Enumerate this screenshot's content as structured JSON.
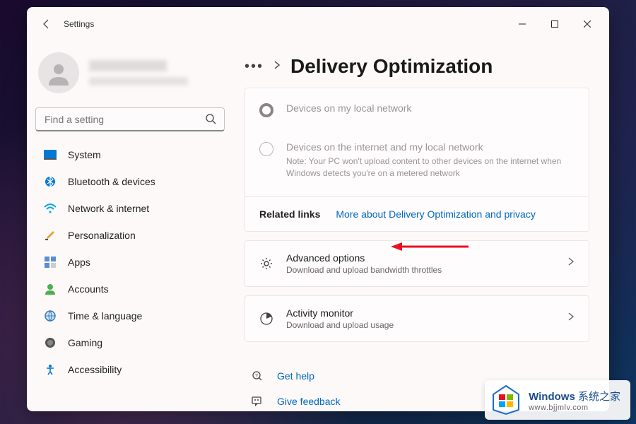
{
  "window": {
    "title": "Settings"
  },
  "search": {
    "placeholder": "Find a setting"
  },
  "nav": {
    "items": [
      {
        "label": "System"
      },
      {
        "label": "Bluetooth & devices"
      },
      {
        "label": "Network & internet"
      },
      {
        "label": "Personalization"
      },
      {
        "label": "Apps"
      },
      {
        "label": "Accounts"
      },
      {
        "label": "Time & language"
      },
      {
        "label": "Gaming"
      },
      {
        "label": "Accessibility"
      }
    ]
  },
  "breadcrumb": {
    "page_title": "Delivery Optimization"
  },
  "radios": {
    "option1": "Devices on my local network",
    "option2": "Devices on the internet and my local network",
    "note": "Note: Your PC won't upload content to other devices on the internet when Windows detects you're on a metered network"
  },
  "related": {
    "label": "Related links",
    "link": "More about Delivery Optimization and privacy"
  },
  "advanced": {
    "title": "Advanced options",
    "sub": "Download and upload bandwidth throttles"
  },
  "activity": {
    "title": "Activity monitor",
    "sub": "Download and upload usage"
  },
  "help": {
    "get_help": "Get help",
    "feedback": "Give feedback"
  },
  "watermark": {
    "brand": "Windows",
    "suffix": "系统之家",
    "url": "www.bjjmlv.com"
  }
}
